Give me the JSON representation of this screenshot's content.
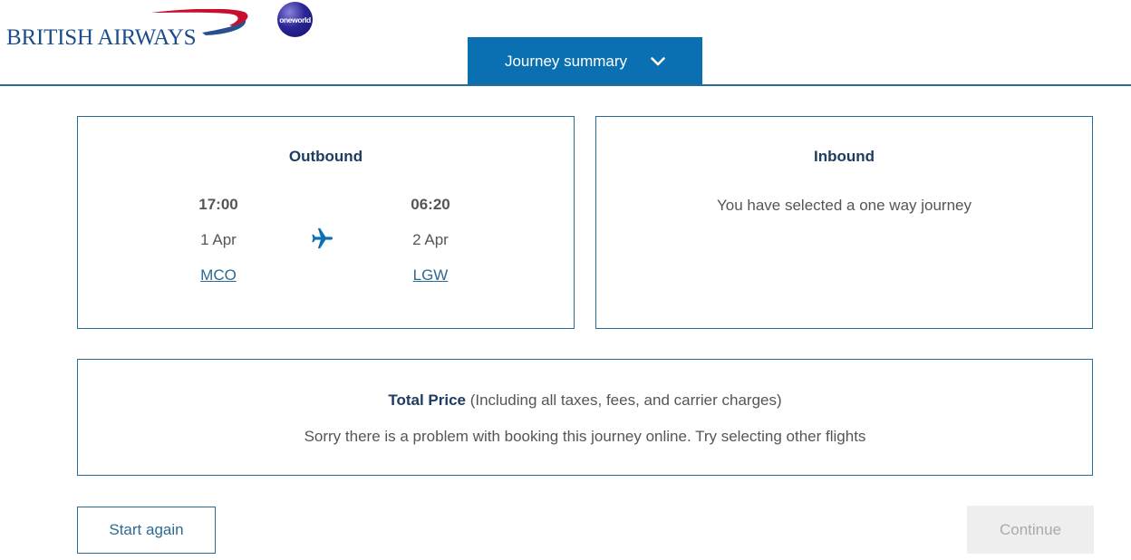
{
  "header": {
    "logo_text": "BRITISH AIRWAYS",
    "alliance_logo_text": "oneworld",
    "journey_summary_label": "Journey summary"
  },
  "outbound": {
    "title": "Outbound",
    "depart": {
      "time": "17:00",
      "date": "1 Apr",
      "airport": "MCO"
    },
    "arrive": {
      "time": "06:20",
      "date": "2 Apr",
      "airport": "LGW"
    }
  },
  "inbound": {
    "title": "Inbound",
    "message": "You have selected a one way journey"
  },
  "price": {
    "label": "Total Price",
    "note": " (Including all taxes, fees, and carrier charges)",
    "message": "Sorry there is a problem with booking this journey online. Try selecting other flights"
  },
  "actions": {
    "start_again": "Start again",
    "continue": "Continue"
  },
  "colors": {
    "brand_blue": "#0b70b2",
    "navy": "#1d3c62",
    "border": "#2b6a94",
    "swoosh_red": "#c8102e"
  }
}
